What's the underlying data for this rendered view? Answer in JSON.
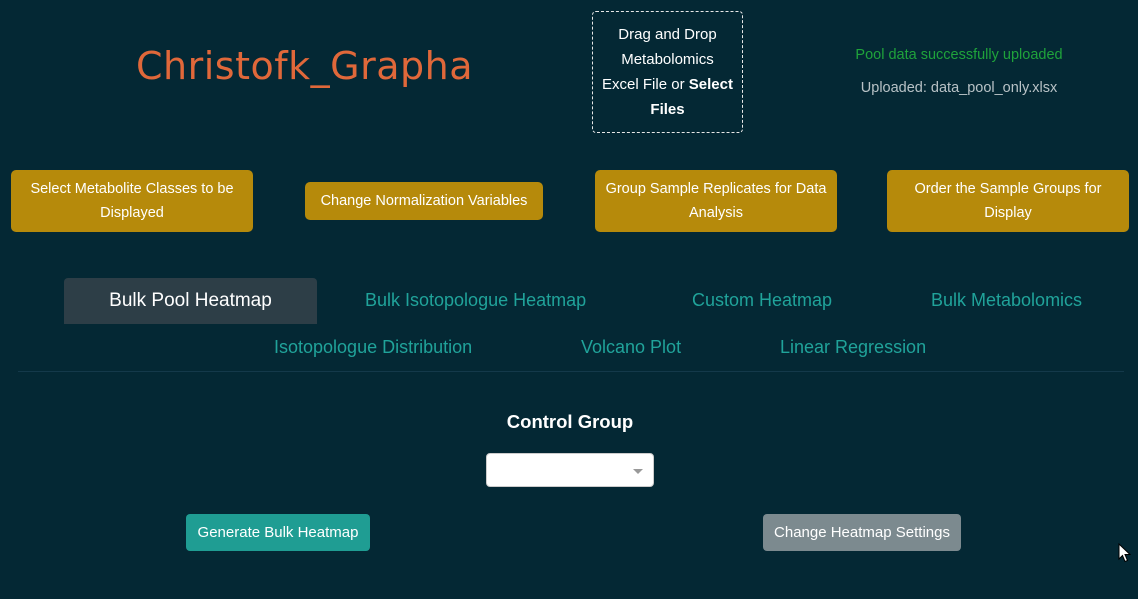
{
  "header": {
    "app_title": "Christofk_Grapha",
    "upload": {
      "line1": "Drag and Drop",
      "line2": "Metabolomics",
      "line3_prefix": "Excel File or ",
      "line3_bold": "Select",
      "line4_bold": "Files"
    },
    "status_message": "Pool data successfully uploaded",
    "uploaded_file": "Uploaded: data_pool_only.xlsx"
  },
  "actions": {
    "select_classes": "Select Metabolite Classes to be Displayed",
    "normalization": "Change Normalization Variables",
    "group_replicates": "Group Sample Replicates for Data Analysis",
    "order_groups": "Order the Sample Groups for Display"
  },
  "tabs": [
    {
      "label": "Bulk Pool Heatmap",
      "active": true
    },
    {
      "label": "Bulk Isotopologue Heatmap",
      "active": false
    },
    {
      "label": "Custom Heatmap",
      "active": false
    },
    {
      "label": "Bulk Metabolomics",
      "active": false
    },
    {
      "label": "Isotopologue Distribution",
      "active": false
    },
    {
      "label": "Volcano Plot",
      "active": false
    },
    {
      "label": "Linear Regression",
      "active": false
    }
  ],
  "panel": {
    "control_group_label": "Control Group",
    "control_group_value": "",
    "generate_button": "Generate Bulk Heatmap",
    "settings_button": "Change Heatmap Settings"
  },
  "colors": {
    "background": "#042834",
    "title": "#e0683a",
    "action_button": "#b68a0b",
    "tab_text": "#20a39a",
    "active_tab_bg": "#2d3e47",
    "success_text": "#1fa33b",
    "primary_button": "#1f9d93",
    "secondary_button": "#7c8a8f"
  },
  "icons": {
    "select_caret": "chevron-down-icon",
    "cursor": "mouse-pointer-icon"
  }
}
